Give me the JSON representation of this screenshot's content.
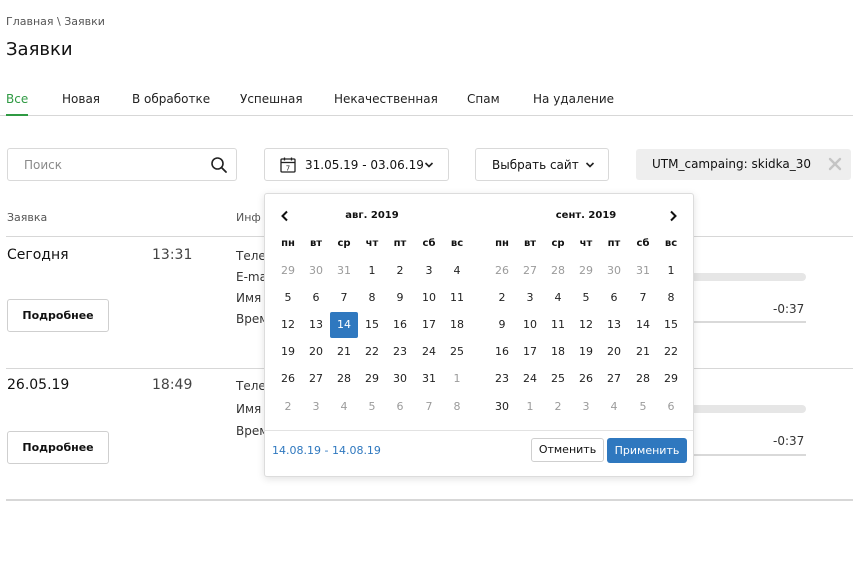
{
  "breadcrumb": "Главная \\ Заявки",
  "title": "Заявки",
  "tabs": [
    {
      "label": "Все",
      "active": true
    },
    {
      "label": "Новая"
    },
    {
      "label": "В обработке"
    },
    {
      "label": "Успешная"
    },
    {
      "label": "Некачественная"
    },
    {
      "label": "Спам"
    },
    {
      "label": "На удаление"
    }
  ],
  "search": {
    "placeholder": "Поиск"
  },
  "date_filter": {
    "label": "31.05.19 - 03.06.19"
  },
  "site_filter": {
    "label": "Выбрать сайт"
  },
  "utm_tag": {
    "label": "UTM_campaing:  skidka_30"
  },
  "columns": {
    "request": "Заявка",
    "info": "Инф"
  },
  "requests": [
    {
      "date": "Сегодня",
      "time": "13:31",
      "info_labels": [
        "Теле",
        "E-ma",
        "Имя",
        "Врем"
      ],
      "button": "Подробнее",
      "progress": 0.02,
      "duration": "-0:37"
    },
    {
      "date": "26.05.19",
      "time": "18:49",
      "info_labels": [
        "Теле",
        "Имя",
        "Врем"
      ],
      "button": "Подробнее",
      "progress": 0.0,
      "duration": "-0:37"
    }
  ],
  "datepicker": {
    "weekdays": [
      "пн",
      "вт",
      "ср",
      "чт",
      "пт",
      "сб",
      "вс"
    ],
    "months": [
      {
        "title": "авг. 2019",
        "weeks": [
          [
            {
              "d": "29",
              "muted": true
            },
            {
              "d": "30",
              "muted": true
            },
            {
              "d": "31",
              "muted": true
            },
            {
              "d": "1"
            },
            {
              "d": "2"
            },
            {
              "d": "3"
            },
            {
              "d": "4"
            }
          ],
          [
            {
              "d": "5"
            },
            {
              "d": "6"
            },
            {
              "d": "7"
            },
            {
              "d": "8"
            },
            {
              "d": "9"
            },
            {
              "d": "10"
            },
            {
              "d": "11"
            }
          ],
          [
            {
              "d": "12"
            },
            {
              "d": "13"
            },
            {
              "d": "14",
              "selected": true
            },
            {
              "d": "15"
            },
            {
              "d": "16"
            },
            {
              "d": "17"
            },
            {
              "d": "18"
            }
          ],
          [
            {
              "d": "19"
            },
            {
              "d": "20"
            },
            {
              "d": "21"
            },
            {
              "d": "22"
            },
            {
              "d": "23"
            },
            {
              "d": "24"
            },
            {
              "d": "25"
            }
          ],
          [
            {
              "d": "26"
            },
            {
              "d": "27"
            },
            {
              "d": "28"
            },
            {
              "d": "29"
            },
            {
              "d": "30"
            },
            {
              "d": "31"
            },
            {
              "d": "1",
              "muted": true
            }
          ],
          [
            {
              "d": "2",
              "muted": true
            },
            {
              "d": "3",
              "muted": true
            },
            {
              "d": "4",
              "muted": true
            },
            {
              "d": "5",
              "muted": true
            },
            {
              "d": "6",
              "muted": true
            },
            {
              "d": "7",
              "muted": true
            },
            {
              "d": "8",
              "muted": true
            }
          ]
        ]
      },
      {
        "title": "сент. 2019",
        "weeks": [
          [
            {
              "d": "26",
              "muted": true
            },
            {
              "d": "27",
              "muted": true
            },
            {
              "d": "28",
              "muted": true
            },
            {
              "d": "29",
              "muted": true
            },
            {
              "d": "30",
              "muted": true
            },
            {
              "d": "31",
              "muted": true
            },
            {
              "d": "1"
            }
          ],
          [
            {
              "d": "2"
            },
            {
              "d": "3"
            },
            {
              "d": "4"
            },
            {
              "d": "5"
            },
            {
              "d": "6"
            },
            {
              "d": "7"
            },
            {
              "d": "8"
            }
          ],
          [
            {
              "d": "9"
            },
            {
              "d": "10"
            },
            {
              "d": "11"
            },
            {
              "d": "12"
            },
            {
              "d": "13"
            },
            {
              "d": "14"
            },
            {
              "d": "15"
            }
          ],
          [
            {
              "d": "16"
            },
            {
              "d": "17"
            },
            {
              "d": "18"
            },
            {
              "d": "19"
            },
            {
              "d": "20"
            },
            {
              "d": "21"
            },
            {
              "d": "22"
            }
          ],
          [
            {
              "d": "23"
            },
            {
              "d": "24"
            },
            {
              "d": "25"
            },
            {
              "d": "26"
            },
            {
              "d": "27"
            },
            {
              "d": "28"
            },
            {
              "d": "29"
            }
          ],
          [
            {
              "d": "30"
            },
            {
              "d": "1",
              "muted": true
            },
            {
              "d": "2",
              "muted": true
            },
            {
              "d": "3",
              "muted": true
            },
            {
              "d": "4",
              "muted": true
            },
            {
              "d": "5",
              "muted": true
            },
            {
              "d": "6",
              "muted": true
            }
          ]
        ]
      }
    ],
    "range_text": "14.08.19 - 14.08.19",
    "cancel": "Отменить",
    "apply": "Применить"
  },
  "colors": {
    "accent_green": "#2f9a43",
    "accent_blue": "#2f78bf"
  }
}
